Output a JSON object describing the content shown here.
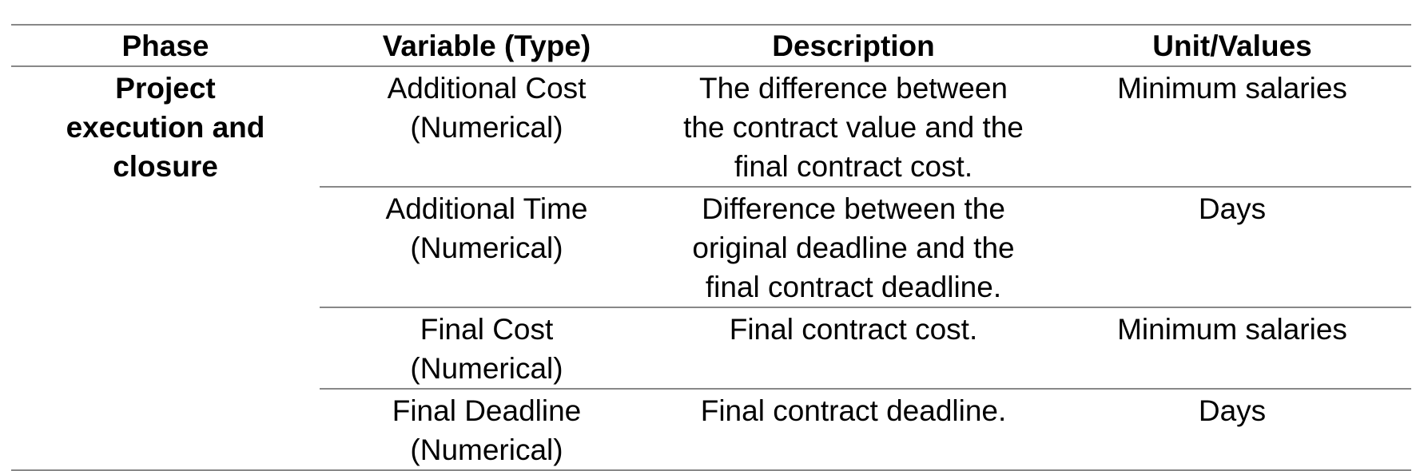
{
  "headers": [
    "Phase",
    "Variable (Type)",
    "Description",
    "Unit/Values"
  ],
  "phase": [
    "Project",
    "execution and",
    "closure"
  ],
  "rows": [
    {
      "variable": [
        "Additional Cost",
        "(Numerical)"
      ],
      "description": [
        "The difference between",
        "the contract value and the",
        "final contract cost."
      ],
      "unit": "Minimum salaries"
    },
    {
      "variable": [
        "Additional Time",
        "(Numerical)"
      ],
      "description": [
        "Difference between the",
        "original deadline and the",
        "final contract deadline."
      ],
      "unit": "Days"
    },
    {
      "variable": [
        "Final Cost",
        "(Numerical)"
      ],
      "description": [
        "Final contract cost."
      ],
      "unit": "Minimum salaries"
    },
    {
      "variable": [
        "Final Deadline",
        "(Numerical)"
      ],
      "description": [
        "Final contract deadline."
      ],
      "unit": "Days"
    }
  ]
}
